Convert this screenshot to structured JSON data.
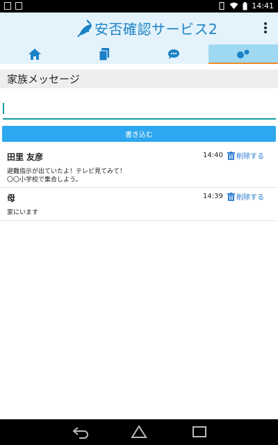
{
  "status_bar": {
    "time": "14:41"
  },
  "header": {
    "app_title": "安否確認サービス2"
  },
  "tabs": [
    {
      "icon": "home-icon"
    },
    {
      "icon": "documents-icon"
    },
    {
      "icon": "chat-icon"
    },
    {
      "icon": "family-icon",
      "active": true
    }
  ],
  "section": {
    "title": "家族メッセージ"
  },
  "compose": {
    "value": "",
    "submit_label": "書き込む"
  },
  "messages": [
    {
      "author": "田里 友彦",
      "time": "14:40",
      "delete_label": "削除する",
      "body_lines": [
        "避難指示が出ていたよ！テレビ見てみて！",
        "〇〇小学校で集合しよう。"
      ]
    },
    {
      "author": "母",
      "time": "14:39",
      "delete_label": "削除する",
      "body_lines": [
        "家にいます"
      ]
    }
  ],
  "colors": {
    "accent": "#2da7ef",
    "brand": "#1c82c6",
    "tab_active": "#9ed8f2",
    "tab_indicator": "#ef8a25",
    "input_underline": "#119b9e",
    "delete_link": "#2a7bd0"
  }
}
